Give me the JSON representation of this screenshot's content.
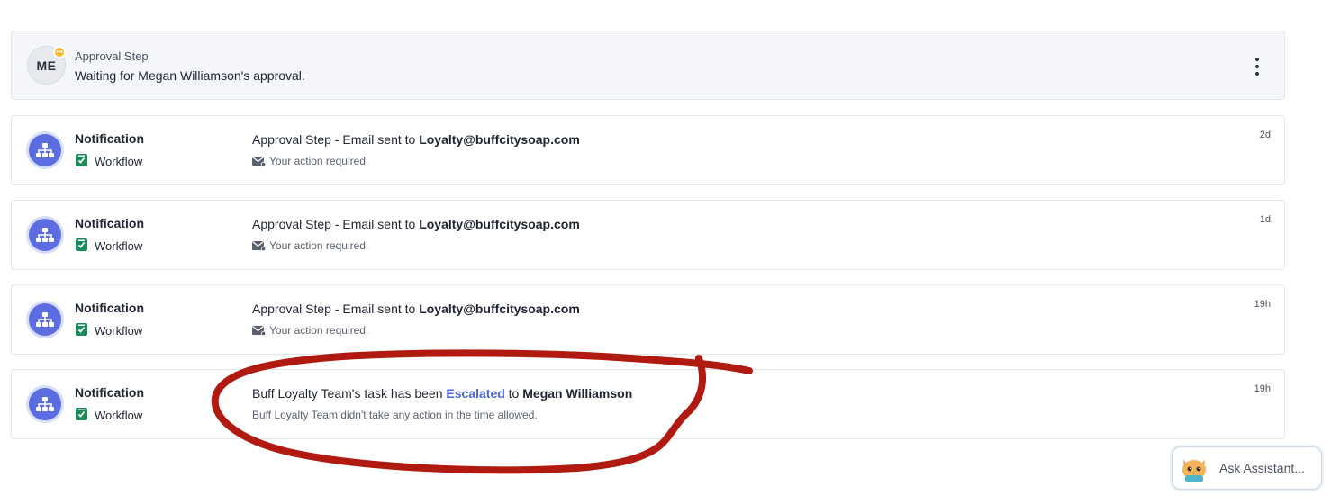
{
  "approval": {
    "avatar_initials": "ME",
    "label": "Approval Step",
    "text": "Waiting for Megan Williamson's approval.",
    "badge_color": "#f5b82e",
    "menu_icon": "kebab-icon"
  },
  "notifications": [
    {
      "title": "Notification",
      "source": "Workflow",
      "message_prefix": "Approval Step - Email sent to ",
      "message_bold": "Loyalty@buffcitysoap.com",
      "sub": "Your action required.",
      "time": "2d"
    },
    {
      "title": "Notification",
      "source": "Workflow",
      "message_prefix": "Approval Step - Email sent to ",
      "message_bold": "Loyalty@buffcitysoap.com",
      "sub": "Your action required.",
      "time": "1d"
    },
    {
      "title": "Notification",
      "source": "Workflow",
      "message_prefix": "Approval Step - Email sent to ",
      "message_bold": "Loyalty@buffcitysoap.com",
      "sub": "Your action required.",
      "time": "19h"
    },
    {
      "title": "Notification",
      "source": "Workflow",
      "message_prefix": "Buff Loyalty Team's task has been ",
      "message_link": "Escalated",
      "message_middle": " to ",
      "message_bold": "Megan Williamson",
      "sub": "Buff Loyalty Team didn't take any action in the time allowed.",
      "time": "19h"
    }
  ],
  "assistant": {
    "label": "Ask Assistant..."
  },
  "colors": {
    "accent": "#5b6de0",
    "link": "#4a63d6",
    "workflow_green": "#1c8a5a",
    "annotation_red": "#b01a10"
  }
}
